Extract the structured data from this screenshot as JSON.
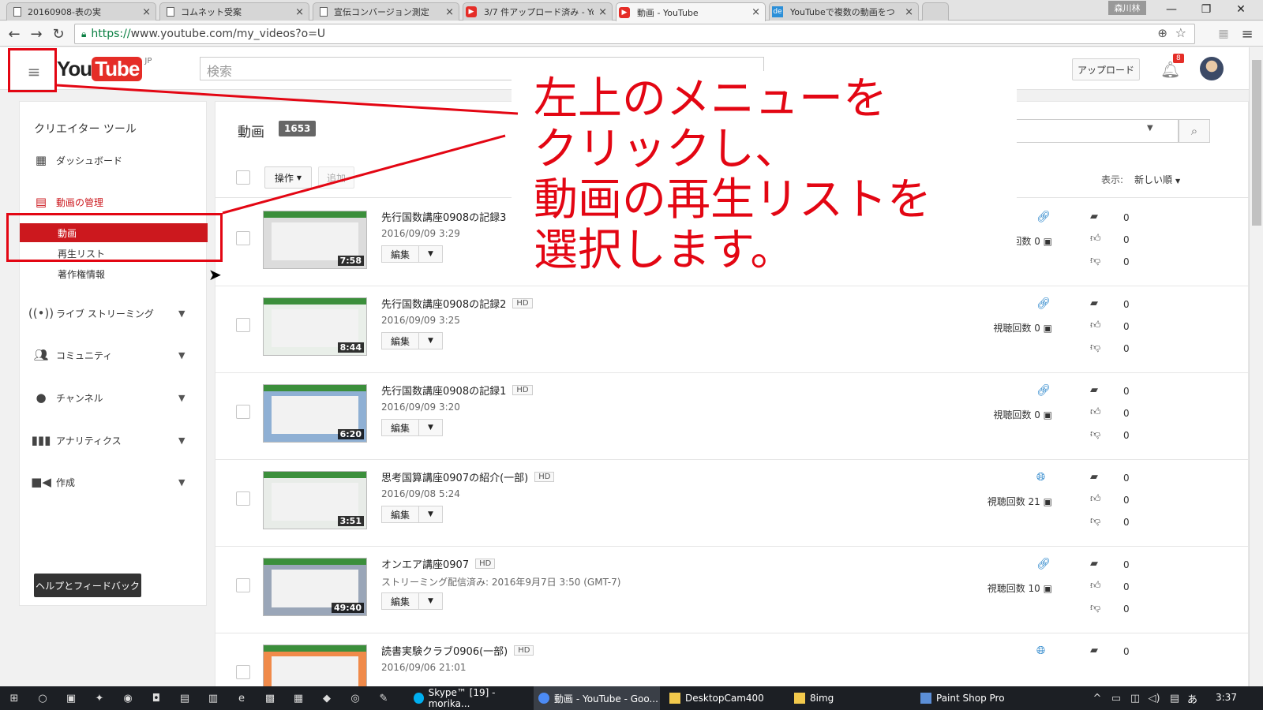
{
  "browser": {
    "tabs": [
      {
        "title": "20160908-表の実",
        "icon": "document-icon"
      },
      {
        "title": "コムネット受案",
        "icon": "document-icon"
      },
      {
        "title": "宣伝コンバージョン測定",
        "icon": "document-icon"
      },
      {
        "title": "3/7 件アップロード済み - You",
        "icon": "youtube-icon"
      },
      {
        "title": "動画 - YouTube",
        "icon": "youtube-icon",
        "active": true
      },
      {
        "title": "YouTubeで複数の動画をつ",
        "icon": "de-icon"
      }
    ],
    "profile_name": "森川林",
    "url_scheme": "https://",
    "url_rest": "www.youtube.com/my_videos?o=U"
  },
  "youtube": {
    "region": "JP",
    "search_placeholder": "検索",
    "upload_label": "アップロード",
    "notification_count": "8"
  },
  "sidebar": {
    "title": "クリエイター ツール",
    "dashboard": "ダッシュボード",
    "video_manager": "動画の管理",
    "sub_items": [
      "動画",
      "再生リスト",
      "著作権情報"
    ],
    "live": "ライブ ストリーミング",
    "community": "コミュニティ",
    "channel": "チャンネル",
    "analytics": "アナリティクス",
    "create": "作成",
    "help": "ヘルプとフィードバック"
  },
  "main": {
    "title": "動画",
    "count": "1653",
    "action_label": "操作",
    "add_label": "追加",
    "sort_label": "表示:",
    "sort_value": "新しい順"
  },
  "videos": [
    {
      "title": "先行国数講座0908の記録3",
      "hd": "",
      "date": "2016/09/09 3:29",
      "duration": "7:58",
      "views": "聴回数 0",
      "visibility": "link-icon",
      "comments": "0",
      "likes": "0",
      "dislikes": "0"
    },
    {
      "title": "先行国数講座0908の記録2",
      "hd": "HD",
      "date": "2016/09/09 3:25",
      "duration": "8:44",
      "views": "視聴回数 0",
      "visibility": "link-icon",
      "comments": "0",
      "likes": "0",
      "dislikes": "0"
    },
    {
      "title": "先行国数講座0908の記録1",
      "hd": "HD",
      "date": "2016/09/09 3:20",
      "duration": "6:20",
      "views": "視聴回数 0",
      "visibility": "link-icon",
      "comments": "0",
      "likes": "0",
      "dislikes": "0"
    },
    {
      "title": "思考国算講座0907の紹介(一部)",
      "hd": "HD",
      "date": "2016/09/08 5:24",
      "duration": "3:51",
      "views": "視聴回数 21",
      "visibility": "globe-icon",
      "comments": "0",
      "likes": "0",
      "dislikes": "0"
    },
    {
      "title": "オンエア講座0907",
      "hd": "HD",
      "date": "ストリーミング配信済み: 2016年9月7日 3:50 (GMT-7)",
      "duration": "49:40",
      "views": "視聴回数 10",
      "visibility": "link-icon",
      "comments": "0",
      "likes": "0",
      "dislikes": "0"
    },
    {
      "title": "読書実験クラブ0906(一部)",
      "hd": "HD",
      "date": "2016/09/06 21:01",
      "duration": "",
      "views": "",
      "visibility": "globe-icon",
      "comments": "0",
      "likes": "",
      "dislikes": ""
    }
  ],
  "edit_label": "編集",
  "annotation": "左上のメニューを\nクリックし、\n動画の再生リストを\n選択します。",
  "taskbar": {
    "apps": [
      "Skype™ [19] - morika...",
      "動画 - YouTube - Goo...",
      "DesktopCam400",
      "8img",
      "Paint Shop Pro"
    ],
    "ime": "あ",
    "time": "3:37"
  },
  "colors": {
    "accent": "#e30613",
    "youtube_red": "#cc181e",
    "link_blue": "#167ac6"
  }
}
